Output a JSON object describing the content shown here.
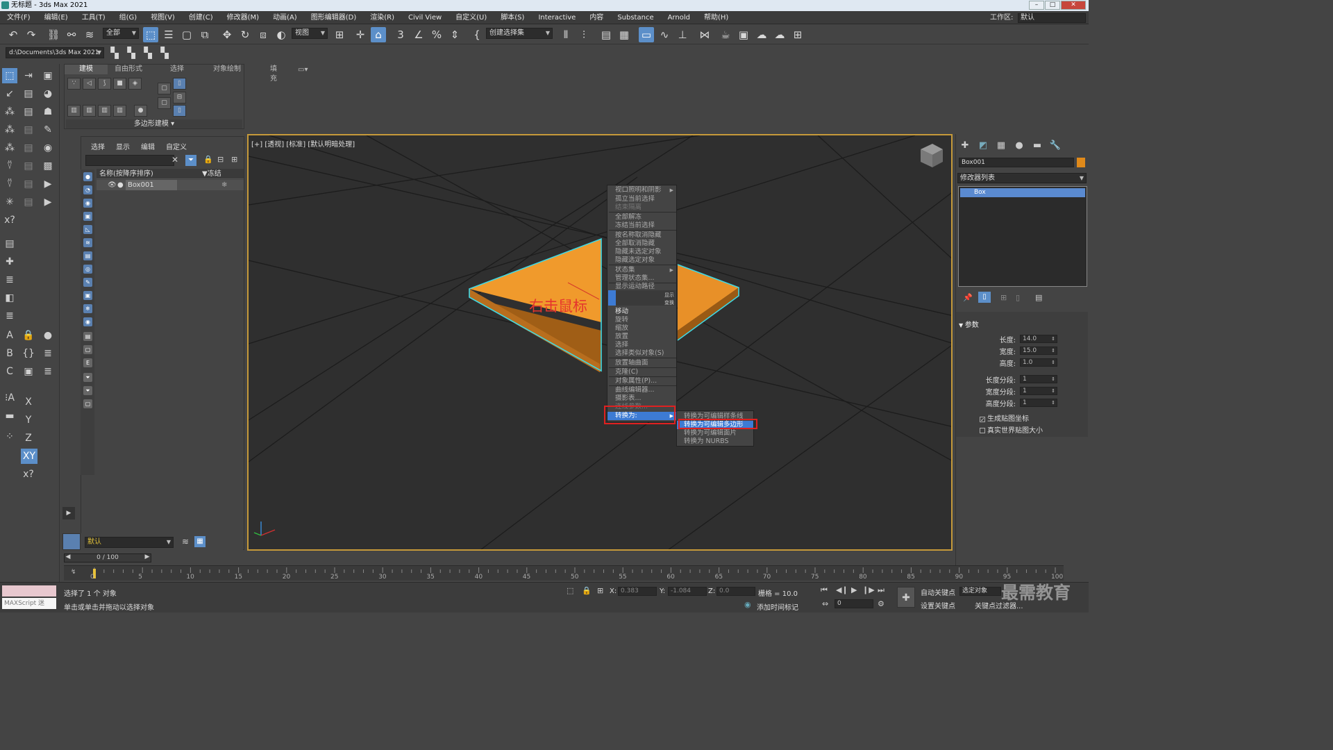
{
  "window": {
    "title": "无标题 - 3ds Max 2021",
    "min": "–",
    "max": "□",
    "close": "✕"
  },
  "menu": [
    "文件(F)",
    "编辑(E)",
    "工具(T)",
    "组(G)",
    "视图(V)",
    "创建(C)",
    "修改器(M)",
    "动画(A)",
    "图形编辑器(D)",
    "渲染(R)",
    "Civil View",
    "自定义(U)",
    "脚本(S)",
    "Interactive",
    "内容",
    "Substance",
    "Arnold",
    "帮助(H)"
  ],
  "workspace": {
    "label": "工作区:",
    "value": "默认"
  },
  "toolbar": {
    "filter": "全部",
    "ref_coord": "视图",
    "named_sel": "创建选择集",
    "path": "d:\\Documents\\3ds Max 2021"
  },
  "ribbon": {
    "tabs": [
      "建模",
      "自由形式",
      "选择",
      "对象绘制",
      "填充"
    ],
    "footer": "多边形建模 ▾"
  },
  "scene_explorer": {
    "tabs": [
      "选择",
      "显示",
      "编辑",
      "自定义"
    ],
    "col_name": "名称(按降序排序)",
    "col_freeze": "▼冻结",
    "row": "Box001"
  },
  "layer": "默认",
  "viewport": {
    "label": "[+] [透视] [标准] [默认明暗处理]",
    "annotation": "右击鼠标"
  },
  "context_menu": {
    "items": [
      "视口照明和阴影",
      "孤立当前选择",
      "结束隔离",
      "全部解冻",
      "冻结当前选择",
      "按名称取消隐藏",
      "全部取消隐藏",
      "隐藏未选定对象",
      "隐藏选定对象",
      "状态集",
      "管理状态集...",
      "显示运动路径"
    ],
    "quad_labels": [
      "显示",
      "变换"
    ],
    "transform_items": [
      "移动",
      "旋转",
      "缩放",
      "放置",
      "选择",
      "选择类似对象(S)",
      "放置轴曲面",
      "克隆(C)",
      "对象属性(P)...",
      "曲线编辑器...",
      "摄影表...",
      "连线参数...",
      "转换为:"
    ],
    "submenu": [
      "转换为可编辑样条线",
      "转换为可编辑多边形",
      "转换为可编辑面片",
      "转换为 NURBS"
    ]
  },
  "command_panel": {
    "object_name": "Box001",
    "modifier_list": "修改器列表",
    "stack_item": "Box",
    "params_title": "参数",
    "params": [
      {
        "label": "长度:",
        "value": "14.0"
      },
      {
        "label": "宽度:",
        "value": "15.0"
      },
      {
        "label": "高度:",
        "value": "1.0"
      },
      {
        "label": "长度分段:",
        "value": "1"
      },
      {
        "label": "宽度分段:",
        "value": "1"
      },
      {
        "label": "高度分段:",
        "value": "1"
      }
    ],
    "check1": "生成贴图坐标",
    "check2": "真实世界贴图大小"
  },
  "timeline": {
    "slider": "0 / 100",
    "ticks": [
      "0",
      "5",
      "10",
      "15",
      "20",
      "25",
      "30",
      "35",
      "40",
      "45",
      "50",
      "55",
      "60",
      "65",
      "70",
      "75",
      "80",
      "85",
      "90",
      "95",
      "100"
    ]
  },
  "status": {
    "maxscript": "MAXScript 迷",
    "selected": "选择了 1 个 对象",
    "hint": "单击或单击并拖动以选择对象",
    "x_label": "X:",
    "x": "0.383",
    "y_label": "Y:",
    "y": "-1.084",
    "z_label": "Z:",
    "z": "0.0",
    "grid": "栅格 = 10.0",
    "add_time_tag": "添加时间标记",
    "auto_key": "自动关键点",
    "sel_obj": "选定对象",
    "set_key": "设置关键点",
    "key_filter": "关键点过滤器...",
    "frame": "0"
  },
  "watermark": "最需教育"
}
